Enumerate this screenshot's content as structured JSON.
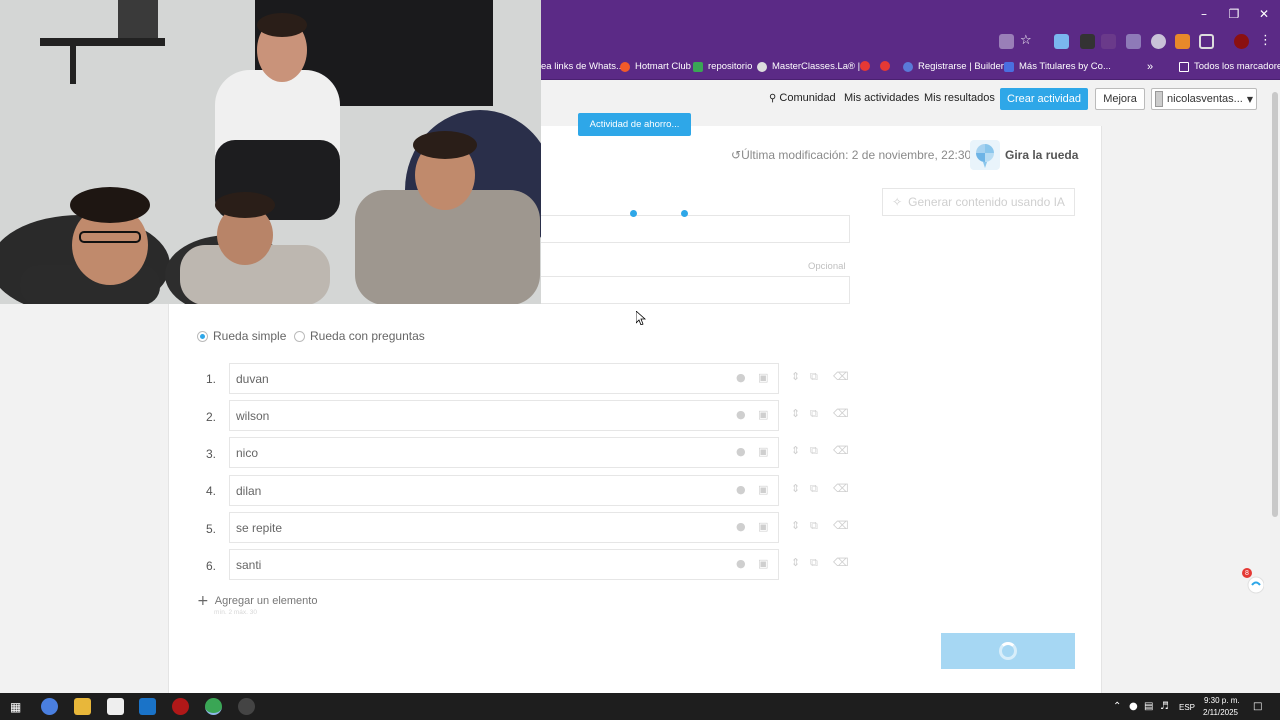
{
  "bookmarks": [
    {
      "label": "ea links de Whats..."
    },
    {
      "label": "Hotmart Club"
    },
    {
      "label": "repositorio"
    },
    {
      "label": "MasterClasses.La® |..."
    },
    {
      "label": "Registrarse | Builder..."
    },
    {
      "label": "Más Titulares by Co..."
    }
  ],
  "bookmarks_more": "»",
  "all_bookmarks": "Todos los marcadores",
  "topnav": {
    "community": "Comunidad",
    "my_activities": "Mis actividades",
    "my_results": "Mis resultados",
    "create": "Crear actividad",
    "upgrade": "Mejora",
    "user": "nicolasventas..."
  },
  "activity_tab": "Actividad de ahorro...",
  "last_modified": "Última modificación: 2 de noviembre, 22:30",
  "template_name": "Gira la rueda",
  "ai_button": "Generar contenido usando IA",
  "optional_label": "Opcional",
  "wheel_options": [
    {
      "label": "Rueda simple",
      "selected": true
    },
    {
      "label": "Rueda con preguntas",
      "selected": false
    }
  ],
  "items": [
    {
      "num": "1.",
      "text": "duvan"
    },
    {
      "num": "2.",
      "text": "wilson"
    },
    {
      "num": "3.",
      "text": "nico"
    },
    {
      "num": "4.",
      "text": "dilan"
    },
    {
      "num": "5.",
      "text": "se repite"
    },
    {
      "num": "6.",
      "text": "santi"
    }
  ],
  "add_item": "Agregar un elemento",
  "min_max": "mín. 2 máx. 30",
  "chat_badge": "8",
  "taskbar": {
    "lang": "ESP",
    "time": "9:30 p. m.",
    "date": "2/11/2025"
  },
  "colors": {
    "chrome": "#5b2a86",
    "accent": "#2ea7e8"
  }
}
